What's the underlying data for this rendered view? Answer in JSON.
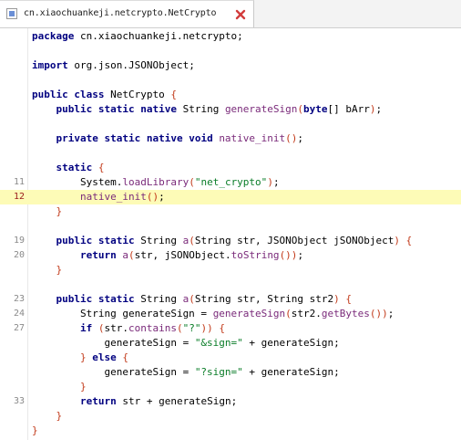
{
  "tab": {
    "title": "cn.xiaochuankeji.netcrypto.NetCrypto",
    "icon": "java-class-file-icon",
    "close_icon": "close-icon"
  },
  "colors": {
    "keyword": "#000080",
    "string": "#0a7d28",
    "method": "#7a2a7a",
    "brace": "#c23a1a",
    "highlight": "#fdfbb7",
    "current_line_number": "#9b1c1c"
  },
  "editor": {
    "current_line": "12",
    "lines": [
      {
        "num": "",
        "tokens": [
          [
            "kw",
            "package"
          ],
          [
            "pl",
            " cn.xiaochuankeji.netcrypto;"
          ]
        ]
      },
      {
        "num": "",
        "tokens": []
      },
      {
        "num": "",
        "tokens": [
          [
            "kw",
            "import"
          ],
          [
            "pl",
            " org.json.JSONObject;"
          ]
        ]
      },
      {
        "num": "",
        "tokens": []
      },
      {
        "num": "",
        "tokens": [
          [
            "kw",
            "public class"
          ],
          [
            "pl",
            " NetCrypto "
          ],
          [
            "br",
            "{"
          ]
        ]
      },
      {
        "num": "",
        "tokens": [
          [
            "pl",
            "    "
          ],
          [
            "kw",
            "public static native"
          ],
          [
            "pl",
            " String "
          ],
          [
            "fn",
            "generateSign"
          ],
          [
            "br",
            "("
          ],
          [
            "kw",
            "byte"
          ],
          [
            "pl",
            "[] bArr"
          ],
          [
            "br",
            ")"
          ],
          [
            "pl",
            ";"
          ]
        ]
      },
      {
        "num": "",
        "tokens": []
      },
      {
        "num": "",
        "tokens": [
          [
            "pl",
            "    "
          ],
          [
            "kw",
            "private static native void"
          ],
          [
            "pl",
            " "
          ],
          [
            "fn",
            "native_init"
          ],
          [
            "br",
            "()"
          ],
          [
            "pl",
            ";"
          ]
        ]
      },
      {
        "num": "",
        "tokens": []
      },
      {
        "num": "",
        "tokens": [
          [
            "pl",
            "    "
          ],
          [
            "kw",
            "static"
          ],
          [
            "pl",
            " "
          ],
          [
            "br",
            "{"
          ]
        ]
      },
      {
        "num": "11",
        "tokens": [
          [
            "pl",
            "        System."
          ],
          [
            "fn",
            "loadLibrary"
          ],
          [
            "br",
            "("
          ],
          [
            "str",
            "\"net_crypto\""
          ],
          [
            "br",
            ")"
          ],
          [
            "pl",
            ";"
          ]
        ]
      },
      {
        "num": "12",
        "tokens": [
          [
            "pl",
            "        "
          ],
          [
            "fn",
            "native_init"
          ],
          [
            "br",
            "()"
          ],
          [
            "pl",
            ";"
          ]
        ]
      },
      {
        "num": "",
        "tokens": [
          [
            "pl",
            "    "
          ],
          [
            "br",
            "}"
          ]
        ]
      },
      {
        "num": "",
        "tokens": []
      },
      {
        "num": "19",
        "tokens": [
          [
            "pl",
            "    "
          ],
          [
            "kw",
            "public static"
          ],
          [
            "pl",
            " String "
          ],
          [
            "fn",
            "a"
          ],
          [
            "br",
            "("
          ],
          [
            "pl",
            "String str, JSONObject jSONObject"
          ],
          [
            "br",
            ")"
          ],
          [
            "pl",
            " "
          ],
          [
            "br",
            "{"
          ]
        ]
      },
      {
        "num": "20",
        "tokens": [
          [
            "pl",
            "        "
          ],
          [
            "kw",
            "return"
          ],
          [
            "pl",
            " "
          ],
          [
            "fn",
            "a"
          ],
          [
            "br",
            "("
          ],
          [
            "pl",
            "str, jSONObject."
          ],
          [
            "fn",
            "toString"
          ],
          [
            "br",
            "())"
          ],
          [
            "pl",
            ";"
          ]
        ]
      },
      {
        "num": "",
        "tokens": [
          [
            "pl",
            "    "
          ],
          [
            "br",
            "}"
          ]
        ]
      },
      {
        "num": "",
        "tokens": []
      },
      {
        "num": "23",
        "tokens": [
          [
            "pl",
            "    "
          ],
          [
            "kw",
            "public static"
          ],
          [
            "pl",
            " String "
          ],
          [
            "fn",
            "a"
          ],
          [
            "br",
            "("
          ],
          [
            "pl",
            "String str, String str2"
          ],
          [
            "br",
            ")"
          ],
          [
            "pl",
            " "
          ],
          [
            "br",
            "{"
          ]
        ]
      },
      {
        "num": "24",
        "tokens": [
          [
            "pl",
            "        String generateSign = "
          ],
          [
            "fn",
            "generateSign"
          ],
          [
            "br",
            "("
          ],
          [
            "pl",
            "str2."
          ],
          [
            "fn",
            "getBytes"
          ],
          [
            "br",
            "())"
          ],
          [
            "pl",
            ";"
          ]
        ]
      },
      {
        "num": "27",
        "tokens": [
          [
            "pl",
            "        "
          ],
          [
            "kw",
            "if"
          ],
          [
            "pl",
            " "
          ],
          [
            "br",
            "("
          ],
          [
            "pl",
            "str."
          ],
          [
            "fn",
            "contains"
          ],
          [
            "br",
            "("
          ],
          [
            "str",
            "\"?\""
          ],
          [
            "br",
            "))"
          ],
          [
            "pl",
            " "
          ],
          [
            "br",
            "{"
          ]
        ]
      },
      {
        "num": "",
        "tokens": [
          [
            "pl",
            "            generateSign = "
          ],
          [
            "str",
            "\"&sign=\""
          ],
          [
            "pl",
            " + generateSign;"
          ]
        ]
      },
      {
        "num": "",
        "tokens": [
          [
            "pl",
            "        "
          ],
          [
            "br",
            "}"
          ],
          [
            "pl",
            " "
          ],
          [
            "kw",
            "else"
          ],
          [
            "pl",
            " "
          ],
          [
            "br",
            "{"
          ]
        ]
      },
      {
        "num": "",
        "tokens": [
          [
            "pl",
            "            generateSign = "
          ],
          [
            "str",
            "\"?sign=\""
          ],
          [
            "pl",
            " + generateSign;"
          ]
        ]
      },
      {
        "num": "",
        "tokens": [
          [
            "pl",
            "        "
          ],
          [
            "br",
            "}"
          ]
        ]
      },
      {
        "num": "33",
        "tokens": [
          [
            "pl",
            "        "
          ],
          [
            "kw",
            "return"
          ],
          [
            "pl",
            " str + generateSign;"
          ]
        ]
      },
      {
        "num": "",
        "tokens": [
          [
            "pl",
            "    "
          ],
          [
            "br",
            "}"
          ]
        ]
      },
      {
        "num": "",
        "tokens": [
          [
            "br",
            "}"
          ]
        ]
      }
    ]
  }
}
